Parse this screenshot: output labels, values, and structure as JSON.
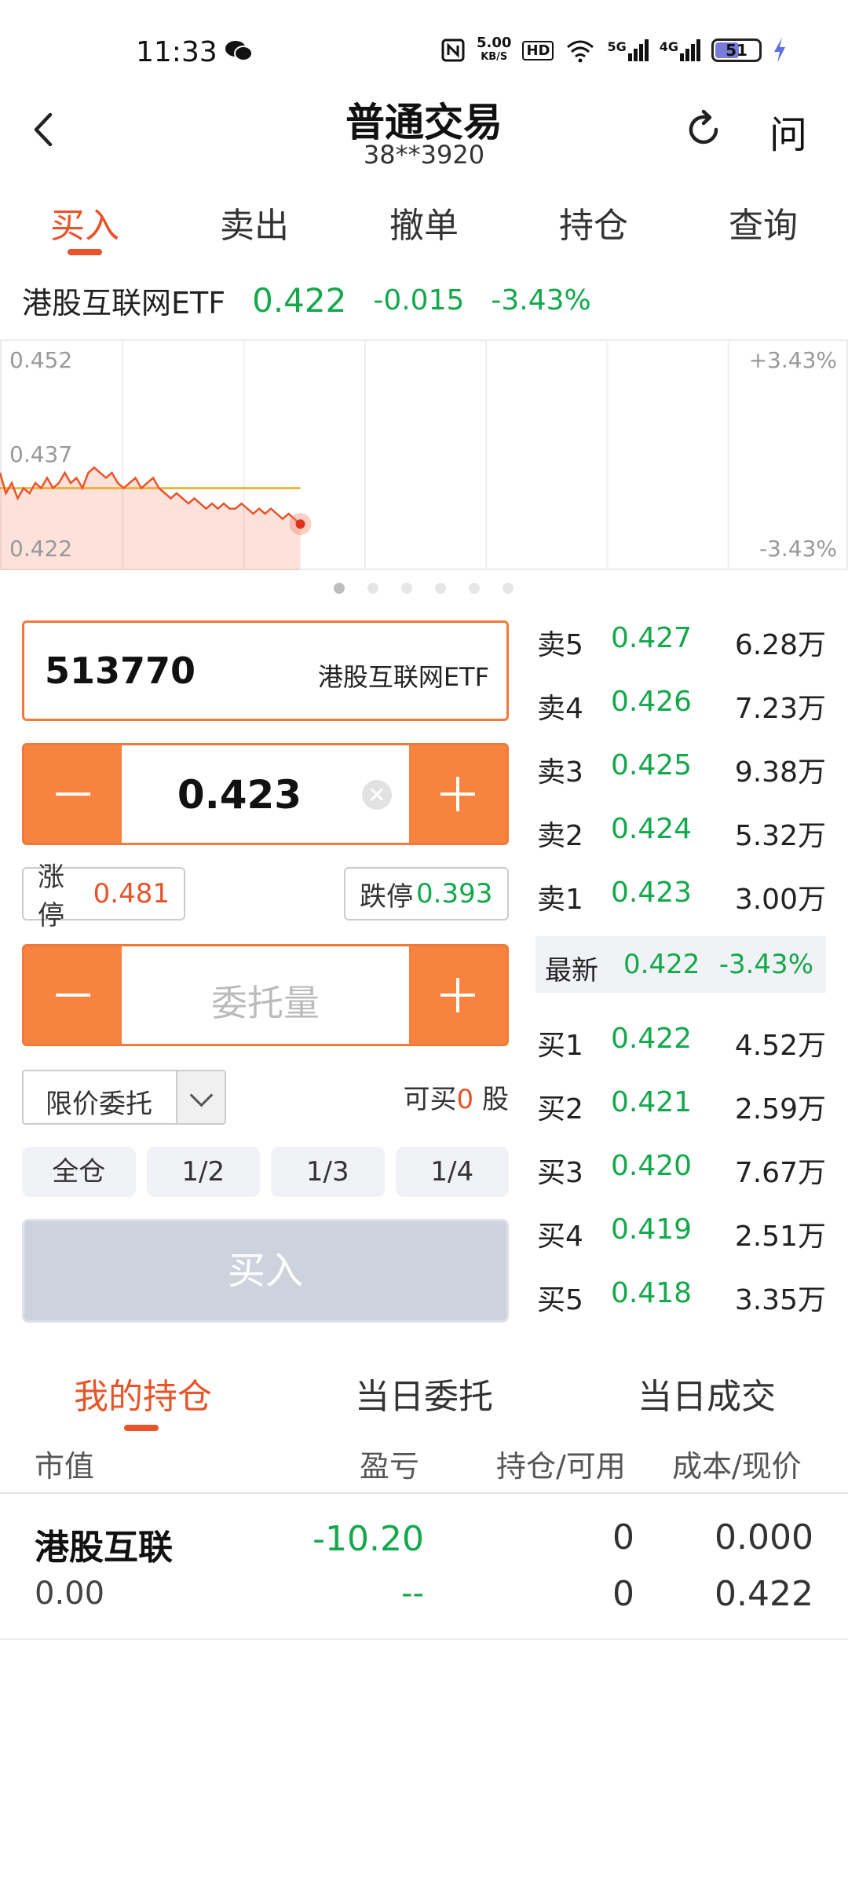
{
  "status_bar": {
    "time": "11:33",
    "net_speed_top": "5.00",
    "net_speed_unit": "KB/S",
    "hd_label": "HD",
    "signal1": "5G",
    "signal2": "4G",
    "battery": "51",
    "icons": [
      "wechat-icon",
      "nfc-icon",
      "hd-icon",
      "wifi-icon",
      "signal-icon",
      "battery-icon",
      "charging-icon"
    ]
  },
  "header": {
    "title": "普通交易",
    "account": "38**3920",
    "help_label": "问",
    "icons": [
      "back-icon",
      "refresh-icon"
    ]
  },
  "tabs": [
    {
      "label": "买入",
      "active": true
    },
    {
      "label": "卖出",
      "active": false
    },
    {
      "label": "撤单",
      "active": false
    },
    {
      "label": "持仓",
      "active": false
    },
    {
      "label": "查询",
      "active": false
    }
  ],
  "quote": {
    "name": "港股互联网ETF",
    "price": "0.422",
    "change": "-0.015",
    "change_pct": "-3.43%"
  },
  "chart": {
    "y_top": "0.452",
    "y_mid": "0.437",
    "y_bottom": "0.422",
    "pct_top": "+3.43%",
    "pct_bottom": "-3.43%",
    "pages": 6,
    "current_page": 1
  },
  "chart_data": {
    "type": "line",
    "ylim": [
      0.407,
      0.452
    ],
    "series": [
      {
        "values": [
          0.426,
          0.422,
          0.424,
          0.421,
          0.423,
          0.422,
          0.424,
          0.423,
          0.425,
          0.423,
          0.424,
          0.426,
          0.424,
          0.425,
          0.423,
          0.426,
          0.427,
          0.426,
          0.425,
          0.426,
          0.424,
          0.423,
          0.424,
          0.425,
          0.423,
          0.424,
          0.425,
          0.423,
          0.422,
          0.421,
          0.422,
          0.421,
          0.42,
          0.421,
          0.42,
          0.419,
          0.42,
          0.419,
          0.42,
          0.419,
          0.419,
          0.42,
          0.419,
          0.418,
          0.419,
          0.418,
          0.419,
          0.418,
          0.417,
          0.418,
          0.417,
          0.416
        ]
      },
      {
        "values": [
          0.423,
          0.423,
          0.423,
          0.423,
          0.423,
          0.423,
          0.423,
          0.423,
          0.423,
          0.423,
          0.423,
          0.423,
          0.423,
          0.423,
          0.423,
          0.423,
          0.423,
          0.423,
          0.423,
          0.423,
          0.423,
          0.423,
          0.423,
          0.423,
          0.423,
          0.423,
          0.423,
          0.423,
          0.423,
          0.423,
          0.423,
          0.423,
          0.423,
          0.423,
          0.423,
          0.423,
          0.423,
          0.423,
          0.423,
          0.423,
          0.423,
          0.423,
          0.423,
          0.423,
          0.423,
          0.423,
          0.423,
          0.423,
          0.423,
          0.423,
          0.423,
          0.423
        ]
      }
    ],
    "total_points": 145
  },
  "order_form": {
    "code": "513770",
    "name": "港股互联网ETF",
    "price": "0.423",
    "limit_up_label": "涨停",
    "limit_up_value": "0.481",
    "limit_down_label": "跌停",
    "limit_down_value": "0.393",
    "qty_placeholder": "委托量",
    "order_type": "限价委托",
    "can_buy_prefix": "可买",
    "can_buy_num": "0",
    "can_buy_unit": "股",
    "ratios": [
      "全仓",
      "1/2",
      "1/3",
      "1/4"
    ],
    "submit_label": "买入"
  },
  "order_book": {
    "asks": [
      {
        "label": "卖5",
        "price": "0.427",
        "vol": "6.28万"
      },
      {
        "label": "卖4",
        "price": "0.426",
        "vol": "7.23万"
      },
      {
        "label": "卖3",
        "price": "0.425",
        "vol": "9.38万"
      },
      {
        "label": "卖2",
        "price": "0.424",
        "vol": "5.32万"
      },
      {
        "label": "卖1",
        "price": "0.423",
        "vol": "3.00万"
      }
    ],
    "latest_label": "最新",
    "latest_price": "0.422",
    "latest_pct": "-3.43%",
    "bids": [
      {
        "label": "买1",
        "price": "0.422",
        "vol": "4.52万"
      },
      {
        "label": "买2",
        "price": "0.421",
        "vol": "2.59万"
      },
      {
        "label": "买3",
        "price": "0.420",
        "vol": "7.67万"
      },
      {
        "label": "买4",
        "price": "0.419",
        "vol": "2.51万"
      },
      {
        "label": "买5",
        "price": "0.418",
        "vol": "3.35万"
      }
    ]
  },
  "bottom_tabs": [
    {
      "label": "我的持仓",
      "active": true
    },
    {
      "label": "当日委托",
      "active": false
    },
    {
      "label": "当日成交",
      "active": false
    }
  ],
  "positions": {
    "headers": [
      "市值",
      "盈亏",
      "持仓/可用",
      "成本/现价"
    ],
    "rows": [
      {
        "name": "港股互联",
        "market_value": "0.00",
        "pnl": "-10.20",
        "pnl_pct": "--",
        "hold": "0",
        "available": "0",
        "cost": "0.000",
        "current": "0.422"
      }
    ]
  },
  "colors": {
    "accent": "#e8542a",
    "orange": "#f8823f",
    "up_green": "#14a84c",
    "disabled_btn": "#cdd3dd"
  }
}
